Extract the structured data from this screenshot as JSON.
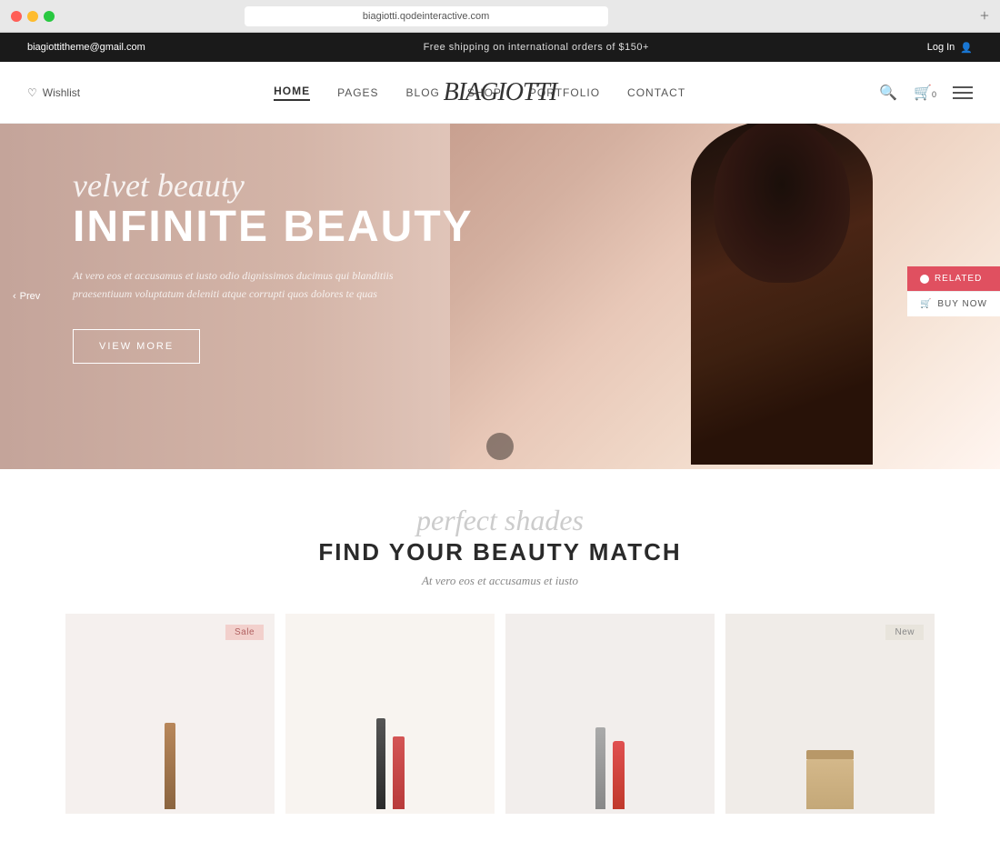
{
  "browser": {
    "url": "biagiotti.qodeinteractive.com",
    "add_tab": "+"
  },
  "topbar": {
    "email": "biagiottitheme@gmail.com",
    "promo": "Free shipping on international orders of $150+",
    "login": "Log In"
  },
  "navbar": {
    "wishlist": "Wishlist",
    "brand": "biagiotti",
    "nav_items": [
      {
        "label": "HOME",
        "active": true
      },
      {
        "label": "PAGES",
        "active": false
      },
      {
        "label": "BLOG",
        "active": false
      },
      {
        "label": "SHOP",
        "active": false
      },
      {
        "label": "PORTFOLIO",
        "active": false
      },
      {
        "label": "CONTACT",
        "active": false
      }
    ],
    "cart_count": "0"
  },
  "hero": {
    "script_text": "velvet beauty",
    "title": "INFINITE BEAUTY",
    "description": "At vero eos et accusamus et iusto odio dignissimos ducimus qui blanditiis praesentiuum voluptatum deleniti atque corrupti quos dolores te quas",
    "cta_label": "VIEW MORE",
    "prev_label": "Prev",
    "related_label": "RELATED",
    "buy_label": "BUY NOW"
  },
  "products": {
    "script_text": "perfect shades",
    "title": "FIND YOUR BEAUTY MATCH",
    "subtitle": "At vero eos et accusamus et iusto",
    "items": [
      {
        "badge": "Sale",
        "badge_type": "sale"
      },
      {
        "badge": "",
        "badge_type": "none"
      },
      {
        "badge": "",
        "badge_type": "none"
      },
      {
        "badge": "New",
        "badge_type": "new"
      }
    ]
  }
}
